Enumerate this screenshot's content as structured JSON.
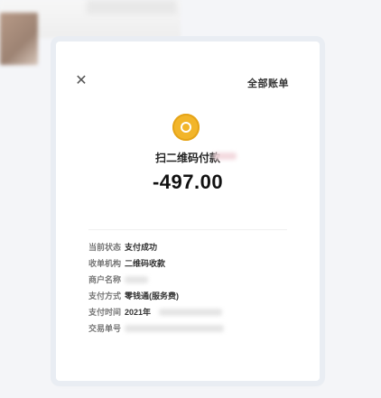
{
  "header": {
    "close_icon": "close-icon",
    "top_right_text": "全部账单"
  },
  "merchant": {
    "icon": "coin-icon",
    "name": "扫二维码付款"
  },
  "amount": "-497.00",
  "details": [
    {
      "key": "当前状态",
      "value": "支付成功"
    },
    {
      "key": "收单机构",
      "value": "二维码收款"
    },
    {
      "key": "商户名称",
      "value": ""
    },
    {
      "key": "支付方式",
      "value": "零钱通(服务费)"
    },
    {
      "key": "支付时间",
      "value": "2021年"
    },
    {
      "key": "交易单号",
      "value": ""
    }
  ]
}
